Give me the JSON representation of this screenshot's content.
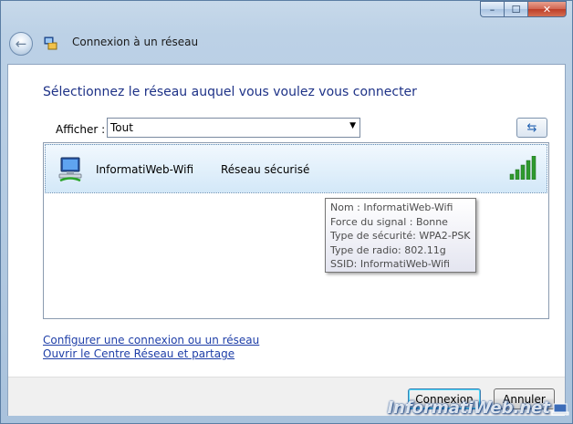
{
  "window": {
    "title": "Connexion à un réseau",
    "close_glyph": "✕",
    "minimize_glyph": "–",
    "maximize_glyph": "☐"
  },
  "heading": "Sélectionnez le réseau auquel vous voulez vous connecter",
  "filter": {
    "label": "Afficher :",
    "value": "Tout"
  },
  "networks": [
    {
      "name": "InformatiWeb-Wifi",
      "security": "Réseau sécurisé",
      "signal_bars": 5,
      "signal_max": 5
    }
  ],
  "tooltip": [
    "Nom : InformatiWeb-Wifi",
    "Force du signal : Bonne",
    "Type de sécurité: WPA2-PSK",
    "Type de radio: 802.11g",
    "SSID: InformatiWeb-Wifi"
  ],
  "links": {
    "setup": "Configurer une connexion ou un réseau",
    "center": "Ouvrir le Centre Réseau et partage"
  },
  "buttons": {
    "connect": "Connexion",
    "cancel": "Annuler"
  },
  "watermark": "InformatiWeb.net",
  "colors": {
    "heading": "#1e3287",
    "link": "#1f3fa8",
    "signal": "#2e9a2e"
  }
}
